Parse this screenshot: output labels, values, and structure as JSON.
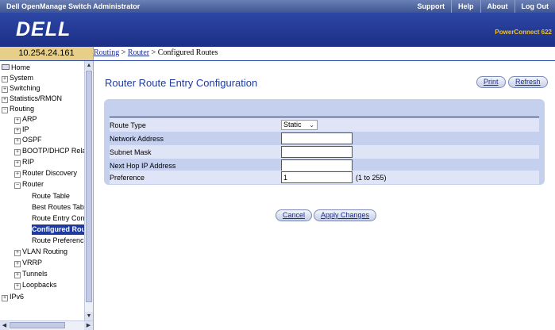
{
  "header": {
    "app_title": "Dell OpenManage Switch Administrator",
    "links": [
      "Support",
      "Help",
      "About",
      "Log Out"
    ],
    "logo": "DELL",
    "product": "PowerConnect 622"
  },
  "ip_address": "10.254.24.161",
  "breadcrumb": {
    "routing": "Routing",
    "sep1": " > ",
    "router": "Router",
    "sep2": " > ",
    "current": "Configured Routes"
  },
  "sidebar": {
    "items": [
      {
        "label": "Home"
      },
      {
        "label": "System"
      },
      {
        "label": "Switching"
      },
      {
        "label": "Statistics/RMON"
      },
      {
        "label": "Routing"
      },
      {
        "label": "ARP"
      },
      {
        "label": "IP"
      },
      {
        "label": "OSPF"
      },
      {
        "label": "BOOTP/DHCP Rela"
      },
      {
        "label": "RIP"
      },
      {
        "label": "Router Discovery"
      },
      {
        "label": "Router"
      },
      {
        "label": "Route Table"
      },
      {
        "label": "Best Routes Tab"
      },
      {
        "label": "Route Entry Con"
      },
      {
        "label": "Configured Rou"
      },
      {
        "label": "Route Preferenc"
      },
      {
        "label": "VLAN Routing"
      },
      {
        "label": "VRRP"
      },
      {
        "label": "Tunnels"
      },
      {
        "label": "Loopbacks"
      },
      {
        "label": "IPv6"
      }
    ]
  },
  "page": {
    "title": "Router Route Entry Configuration",
    "print": "Print",
    "refresh": "Refresh"
  },
  "form": {
    "route_type_label": "Route Type",
    "route_type_value": "Static",
    "network_address_label": "Network Address",
    "network_address_value": "",
    "subnet_mask_label": "Subnet Mask",
    "subnet_mask_value": "",
    "next_hop_label": "Next Hop IP Address",
    "next_hop_value": "",
    "preference_label": "Preference",
    "preference_value": "1",
    "preference_hint": "(1 to 255)"
  },
  "actions": {
    "cancel": "Cancel",
    "apply": "Apply Changes"
  }
}
